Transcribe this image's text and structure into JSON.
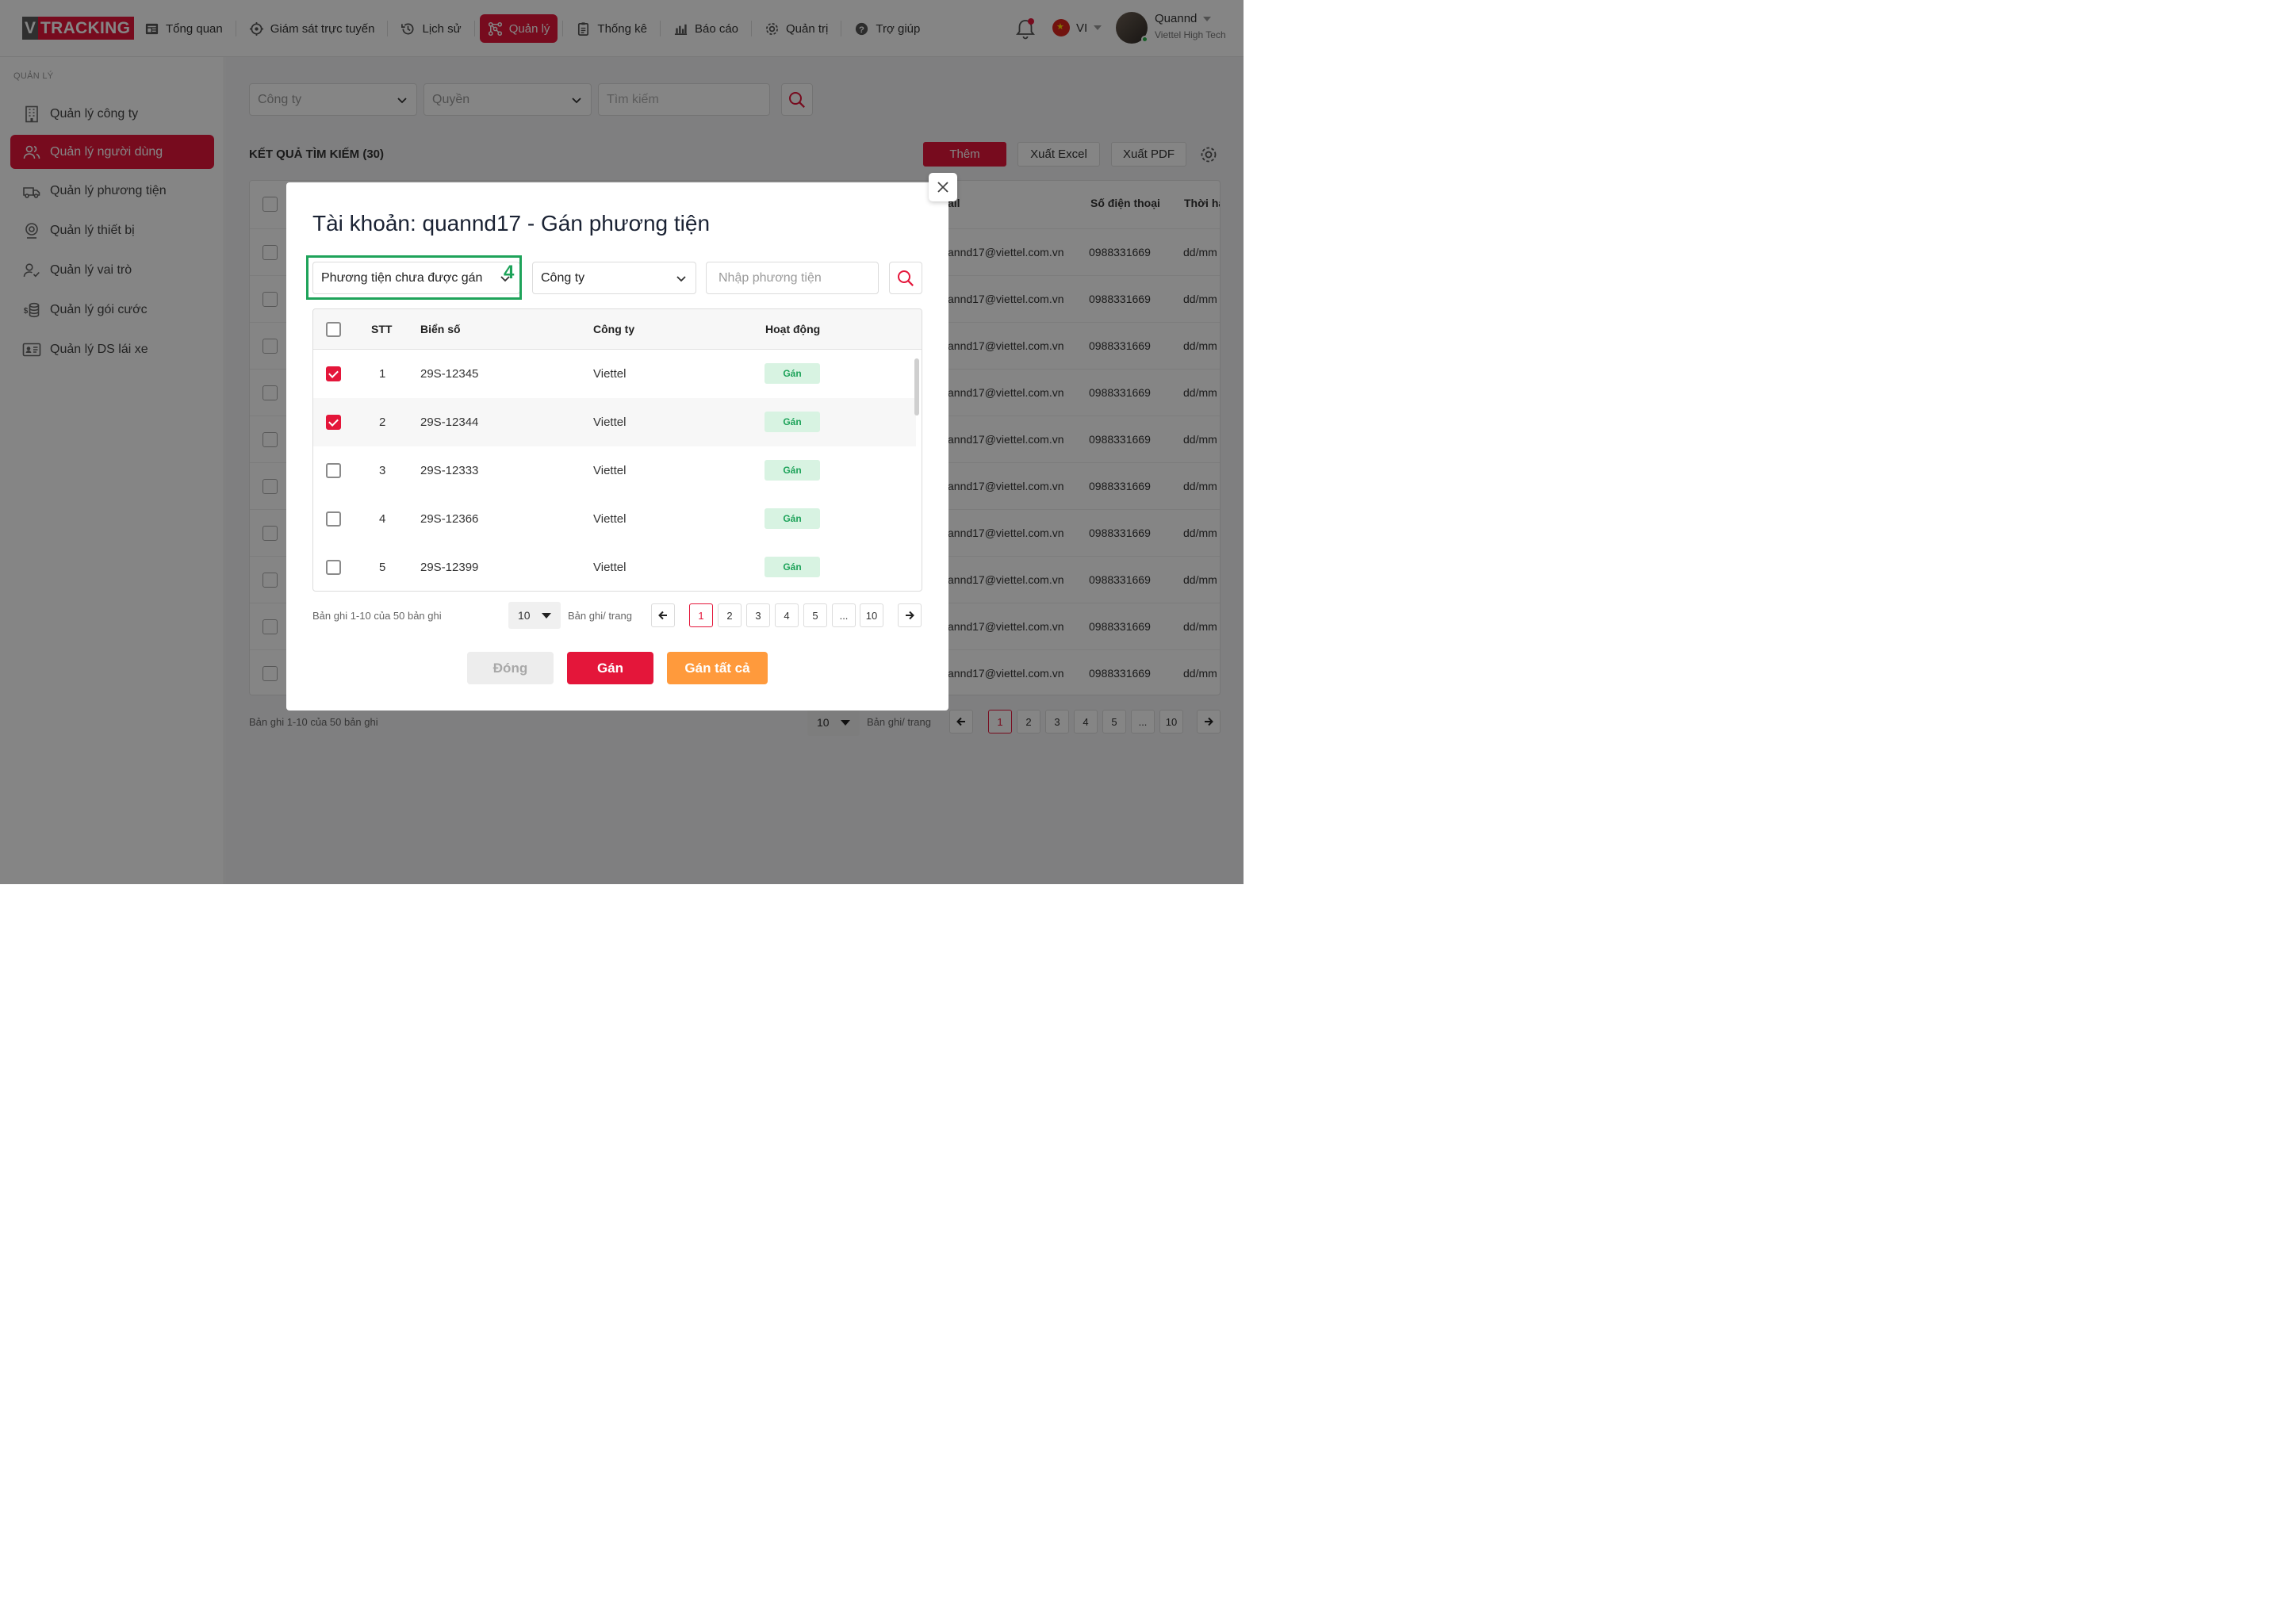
{
  "brand": {
    "v": "V",
    "tracking": "TRACKING"
  },
  "nav": [
    {
      "label": "Tổng quan",
      "icon": "dashboard-icon"
    },
    {
      "label": "Giám sát trực tuyến",
      "icon": "target-icon"
    },
    {
      "label": "Lịch sử",
      "icon": "history-icon"
    },
    {
      "label": "Quản lý",
      "icon": "network-icon",
      "active": true
    },
    {
      "label": "Thống kê",
      "icon": "clipboard-icon"
    },
    {
      "label": "Báo cáo",
      "icon": "bar-chart-icon"
    },
    {
      "label": "Quản trị",
      "icon": "gear-icon"
    },
    {
      "label": "Trợ giúp",
      "icon": "help-icon"
    }
  ],
  "language": "VI",
  "user": {
    "name": "Quannd",
    "org": "Viettel High Tech"
  },
  "sidebar": {
    "heading": "QUẢN LÝ",
    "items": [
      {
        "label": "Quản lý công ty",
        "icon": "building-icon"
      },
      {
        "label": "Quản lý người dùng",
        "icon": "users-icon",
        "active": true
      },
      {
        "label": "Quản lý phương tiện",
        "icon": "truck-icon"
      },
      {
        "label": "Quản lý thiết bị",
        "icon": "gps-device-icon"
      },
      {
        "label": "Quản lý vai trò",
        "icon": "user-check-icon"
      },
      {
        "label": "Quản lý gói cước",
        "icon": "coins-icon"
      },
      {
        "label": "Quản lý DS lái xe",
        "icon": "id-card-icon"
      }
    ]
  },
  "filters": {
    "company": "Công ty",
    "role": "Quyền",
    "search_placeholder": "Tìm kiếm"
  },
  "results_title": "KẾT QUẢ TÌM KIẾM (30)",
  "actions": {
    "add": "Thêm",
    "excel": "Xuất Excel",
    "pdf": "Xuất PDF"
  },
  "bg_table": {
    "headers": {
      "email": "ail",
      "phone": "Số điện thoại",
      "expiry": "Thời hạ"
    },
    "rows": [
      {
        "email": "annd17@viettel.com.vn",
        "phone": "0988331669",
        "expiry": "dd/mm"
      },
      {
        "email": "annd17@viettel.com.vn",
        "phone": "0988331669",
        "expiry": "dd/mm"
      },
      {
        "email": "annd17@viettel.com.vn",
        "phone": "0988331669",
        "expiry": "dd/mm"
      },
      {
        "email": "annd17@viettel.com.vn",
        "phone": "0988331669",
        "expiry": "dd/mm"
      },
      {
        "email": "annd17@viettel.com.vn",
        "phone": "0988331669",
        "expiry": "dd/mm"
      },
      {
        "email": "annd17@viettel.com.vn",
        "phone": "0988331669",
        "expiry": "dd/mm"
      },
      {
        "email": "annd17@viettel.com.vn",
        "phone": "0988331669",
        "expiry": "dd/mm"
      },
      {
        "email": "annd17@viettel.com.vn",
        "phone": "0988331669",
        "expiry": "dd/mm"
      },
      {
        "email": "annd17@viettel.com.vn",
        "phone": "0988331669",
        "expiry": "dd/mm"
      },
      {
        "email": "annd17@viettel.com.vn",
        "phone": "0988331669",
        "expiry": "dd/mm"
      }
    ]
  },
  "pager": {
    "summary": "Bản ghi 1-10 của 50 bản ghi",
    "page_size": "10",
    "per_page_label": "Bản ghi/ trang",
    "pages": [
      "1",
      "2",
      "3",
      "4",
      "5",
      "...",
      "10"
    ],
    "current": "1"
  },
  "modal": {
    "title_account": "Tài khoản: quannd17",
    "title_sep": "-",
    "title_action": "Gán phương tiện",
    "vehicle_filter": "Phương tiện chưa được gán",
    "step": "4",
    "company_filter": "Công ty",
    "vehicle_placeholder": "Nhập phương tiện",
    "headers": {
      "stt": "STT",
      "plate": "Biển số",
      "company": "Công ty",
      "action": "Hoạt động"
    },
    "rows": [
      {
        "stt": "1",
        "plate": "29S-12345",
        "company": "Viettel",
        "action": "Gán",
        "checked": true
      },
      {
        "stt": "2",
        "plate": "29S-12344",
        "company": "Viettel",
        "action": "Gán",
        "checked": true
      },
      {
        "stt": "3",
        "plate": "29S-12333",
        "company": "Viettel",
        "action": "Gán",
        "checked": false
      },
      {
        "stt": "4",
        "plate": "29S-12366",
        "company": "Viettel",
        "action": "Gán",
        "checked": false
      },
      {
        "stt": "5",
        "plate": "29S-12399",
        "company": "Viettel",
        "action": "Gán",
        "checked": false
      }
    ],
    "buttons": {
      "close": "Đóng",
      "assign": "Gán",
      "assign_all": "Gán tất cả"
    }
  },
  "colors": {
    "brand": "#e4163a",
    "success": "#1ea35a",
    "warning": "#ff9a3c"
  }
}
